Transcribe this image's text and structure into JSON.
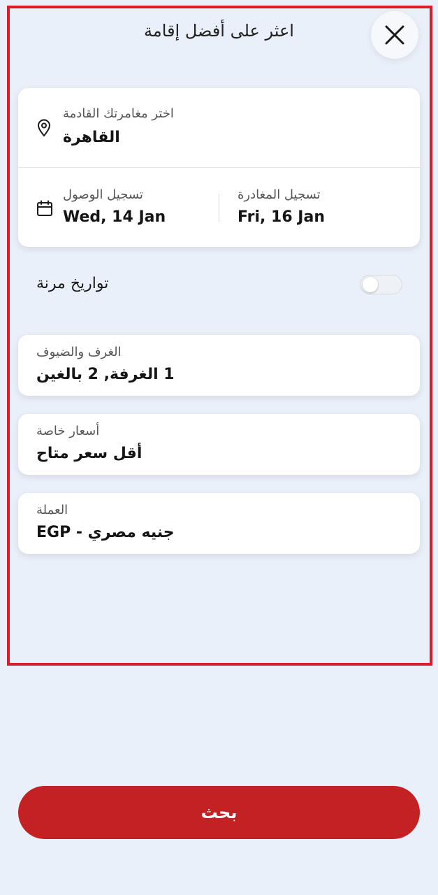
{
  "header": {
    "title": "اعثر على أفضل إقامة"
  },
  "destination": {
    "label": "اختر مغامرتك القادمة",
    "value": "القاهرة"
  },
  "dates": {
    "checkin_label": "تسجيل الوصول",
    "checkin_value": "Wed, 14 Jan",
    "checkout_label": "تسجيل المغادرة",
    "checkout_value": "Fri, 16 Jan"
  },
  "flexible_dates": {
    "label": "تواريخ مرنة",
    "enabled": false
  },
  "rooms": {
    "label": "الغرف والضيوف",
    "value": "1 الغرفة, 2 بالغين"
  },
  "rates": {
    "label": "أسعار خاصة",
    "value": "أقل سعر متاح"
  },
  "currency": {
    "label": "العملة",
    "value": "جنيه مصري - EGP"
  },
  "search_button": {
    "label": "بحث"
  },
  "colors": {
    "accent": "#c42124",
    "frame": "#d81e2a",
    "background": "#eaf0f9"
  }
}
